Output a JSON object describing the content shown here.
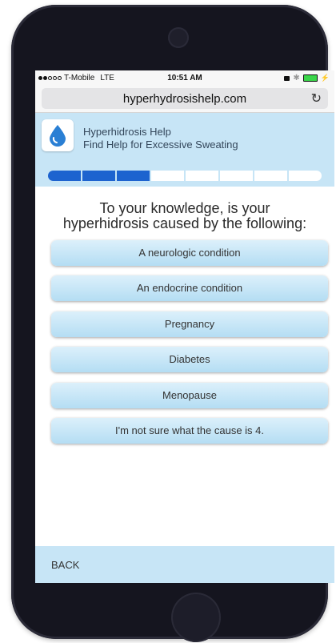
{
  "status_bar": {
    "carrier": "T-Mobile",
    "network": "LTE",
    "time": "10:51 AM"
  },
  "browser": {
    "url": "hyperhydrosishelp.com",
    "reload_icon": "reload-icon"
  },
  "header": {
    "title": "Hyperhidrosis Help",
    "subtitle": "Find Help for Excessive Sweating",
    "logo_icon": "water-drop-icon",
    "progress": {
      "filled_segments": 3,
      "total_segments": 8
    }
  },
  "question": {
    "line1": "To your knowledge, is your",
    "line2": "hyperhidrosis caused by the following:"
  },
  "answers": [
    {
      "label": "A neurologic condition"
    },
    {
      "label": "An endocrine condition"
    },
    {
      "label": "Pregnancy"
    },
    {
      "label": "Diabetes"
    },
    {
      "label": "Menopause"
    },
    {
      "label": "I'm not sure what the cause is 4."
    }
  ],
  "footer": {
    "back_label": "BACK"
  },
  "colors": {
    "header_bg": "#c7e5f6",
    "progress_fill": "#1d63cf",
    "button_top": "#dcf0fb",
    "button_bottom": "#b4ddf3"
  }
}
